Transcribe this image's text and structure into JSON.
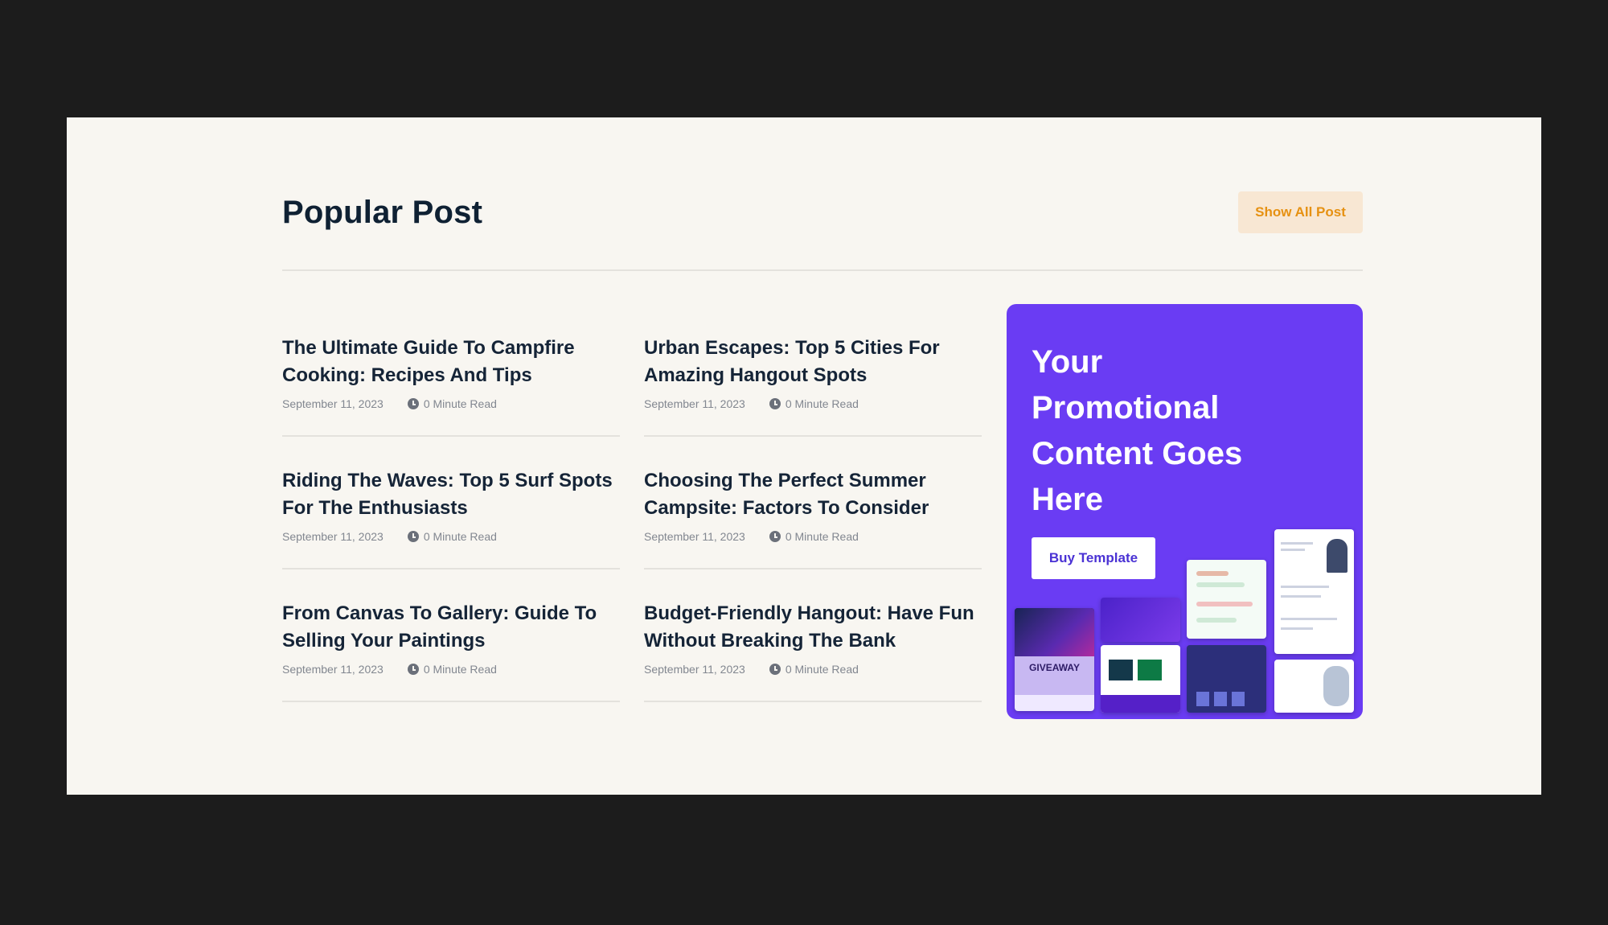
{
  "section": {
    "title": "Popular Post",
    "show_all_label": "Show All Post"
  },
  "posts": [
    {
      "title": "The Ultimate Guide To Campfire Cooking: Recipes And Tips",
      "date": "September 11, 2023",
      "read": "0 Minute Read"
    },
    {
      "title": "Urban Escapes: Top 5 Cities For Amazing Hangout Spots",
      "date": "September 11, 2023",
      "read": "0 Minute Read"
    },
    {
      "title": "Riding The Waves: Top 5 Surf Spots For The Enthusiasts",
      "date": "September 11, 2023",
      "read": "0 Minute Read"
    },
    {
      "title": "Choosing The Perfect Summer Campsite: Factors To Consider",
      "date": "September 11, 2023",
      "read": "0 Minute Read"
    },
    {
      "title": "From Canvas To Gallery: Guide To Selling Your Paintings",
      "date": "September 11, 2023",
      "read": "0 Minute Read"
    },
    {
      "title": "Budget-Friendly Hangout: Have Fun Without Breaking The Bank",
      "date": "September 11, 2023",
      "read": "0 Minute Read"
    }
  ],
  "promo": {
    "text": "Your Promotional Content Goes Here",
    "button_label": "Buy Template",
    "thumbnail_text": "GIVEAWAY"
  },
  "colors": {
    "page_bg": "#f8f6f1",
    "frame_bg": "#1c1c1c",
    "title": "#0f2133",
    "accent": "#e69112",
    "accent_bg": "#f8e7d3",
    "promo_bg": "#6a3cf3",
    "meta": "#828790"
  },
  "icons": {
    "meta_read": "clock-icon"
  }
}
